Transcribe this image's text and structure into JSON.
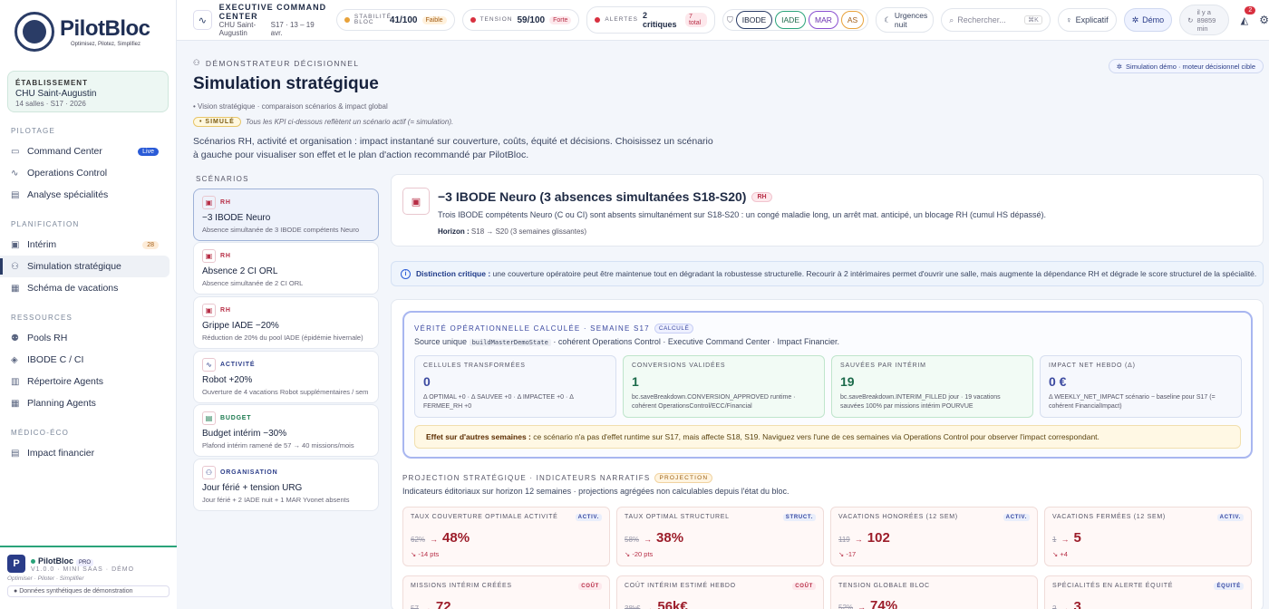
{
  "brand": {
    "name": "PilotBloc",
    "tagline": "Optimisez, Pilotez, Simplifiez"
  },
  "etab": {
    "label": "ÉTABLISSEMENT",
    "name": "CHU Saint-Augustin",
    "sub": "14 salles · S17 · 2026"
  },
  "nav": {
    "pilotage": "PILOTAGE",
    "planification": "PLANIFICATION",
    "ressources": "RESSOURCES",
    "medico": "MÉDICO-ÉCO",
    "command": "Command Center",
    "live": "Live",
    "ops": "Operations Control",
    "analyse": "Analyse spécialités",
    "interim": "Intérim",
    "interim_count": "28",
    "simulation": "Simulation stratégique",
    "vacances": "Schéma de vacations",
    "pools": "Pools RH",
    "ibode": "IBODE C / CI",
    "repertoire": "Répertoire Agents",
    "planning": "Planning Agents",
    "impact": "Impact financier"
  },
  "footer": {
    "initial": "P",
    "name": "PilotBloc",
    "pro": "PRO",
    "version": "V1.0.0 · MINI SAAS · DÉMO",
    "tag": "Optimiser · Piloter · Simplifier",
    "note": "Données synthétiques de démonstration"
  },
  "top": {
    "ecc_title": "EXECUTIVE COMMAND CENTER",
    "ecc_site": "CHU Saint-Augustin",
    "ecc_week": "S17 · 13 – 19 avr.",
    "stab_k": "STABILITÉ BLOC",
    "stab_v": "41/100",
    "stab_tag": "Faible",
    "tens_k": "TENSION",
    "tens_v": "59/100",
    "tens_tag": "Forte",
    "alert_k": "ALERTES",
    "alert_v": "2 critiques",
    "alert_tag": "7 total",
    "chips": [
      "IBODE",
      "IADE",
      "MAR",
      "AS"
    ],
    "urgences": "Urgences nuit",
    "search": "Rechercher...",
    "kbd": "⌘K",
    "explicatif": "Explicatif",
    "demo": "Démo",
    "refresh": "il y a 89859 min",
    "notif": "2"
  },
  "page": {
    "crumb": "DÉMONSTRATEUR DÉCISIONNEL",
    "sim_btn": "Simulation démo · moteur décisionnel cible",
    "title": "Simulation stratégique",
    "vision": "• Vision stratégique · comparaison scénarios & impact global",
    "simtag": "• SIMULÉ",
    "simnote": "Tous les KPI ci-dessous reflètent un scénario actif (= simulation).",
    "desc": "Scénarios RH, activité et organisation : impact instantané sur couverture, coûts, équité et décisions. Choisissez un scénario à gauche pour visualiser son effet et le plan d'action recommandé par PilotBloc.",
    "scen_label": "SCÉNARIOS"
  },
  "scenarios": [
    {
      "k": "RH",
      "t": "−3 IBODE Neuro",
      "s": "Absence simultanée de 3 IBODE compétents Neuro",
      "c": "#b72e46",
      "ic": "▣"
    },
    {
      "k": "RH",
      "t": "Absence 2 CI ORL",
      "s": "Absence simultanée de 2 CI ORL",
      "c": "#b72e46",
      "ic": "▣"
    },
    {
      "k": "RH",
      "t": "Grippe IADE −20%",
      "s": "Réduction de 20% du pool IADE (épidémie hivernale)",
      "c": "#b72e46",
      "ic": "▣"
    },
    {
      "k": "ACTIVITÉ",
      "t": "Robot +20%",
      "s": "Ouverture de 4 vacations Robot supplémentaires / sem",
      "c": "#2a3c88",
      "ic": "∿"
    },
    {
      "k": "BUDGET",
      "t": "Budget intérim −30%",
      "s": "Plafond intérim ramené de 57 → 40 missions/mois",
      "c": "#1b7a4f",
      "ic": "▤"
    },
    {
      "k": "ORGANISATION",
      "t": "Jour férié + tension URG",
      "s": "Jour férié + 2 IADE nuit + 1 MAR Yvonet absents",
      "c": "#2a3c88",
      "ic": "⚇"
    }
  ],
  "detail": {
    "title": "−3 IBODE Neuro (3 absences simultanées S18-S20)",
    "tag": "RH",
    "desc": "Trois IBODE compétents Neuro (C ou CI) sont absents simultanément sur S18-S20 : un congé maladie long, un arrêt mat. anticipé, un blocage RH (cumul HS dépassé).",
    "horizon_k": "Horizon :",
    "horizon_v": "S18 → S20 (3 semaines glissantes)"
  },
  "critical": {
    "k": "Distinction critique :",
    "v": "une couverture opératoire peut être maintenue tout en dégradant la robustesse structurelle. Recourir à 2 intérimaires permet d'ouvrir une salle, mais augmente la dépendance RH et dégrade le score structurel de la spécialité."
  },
  "verite": {
    "title": "VÉRITÉ OPÉRATIONNELLE CALCULÉE · SEMAINE S17",
    "tag": "CALCULÉ",
    "src1": "Source unique",
    "code": "buildMasterDemoState",
    "src2": "· cohérent Operations Control · Executive Command Center · Impact Financier.",
    "boxes": [
      {
        "k": "CELLULES TRANSFORMÉES",
        "v": "0",
        "s": "Δ OPTIMAL +0 · Δ SAUVEE +0 · Δ IMPACTEE +0 · Δ FERMEE_RH +0"
      },
      {
        "k": "CONVERSIONS VALIDÉES",
        "v": "1",
        "s": "bc.saveBreakdown.CONVERSION_APPROVED runtime · cohérent OperationsControl/ECC/Financial"
      },
      {
        "k": "SAUVÉES PAR INTÉRIM",
        "v": "19",
        "s": "bc.saveBreakdown.INTERIM_FILLED jour · 19 vacations sauvées 100% par missions intérim POURVUE"
      },
      {
        "k": "IMPACT NET HEBDO (Δ)",
        "v": "0 €",
        "s": "Δ WEEKLY_NET_IMPACT scénario − baseline pour S17 (= cohérent FinancialImpact)"
      }
    ],
    "effect_k": "Effet sur d'autres semaines :",
    "effect_v": "ce scénario n'a pas d'effet runtime sur S17, mais affecte S18, S19. Naviguez vers l'une de ces semaines via Operations Control pour observer l'impact correspondant."
  },
  "proj": {
    "title": "PROJECTION STRATÉGIQUE · INDICATEURS NARRATIFS",
    "tag": "PROJECTION",
    "sub": "Indicateurs éditoriaux sur horizon 12 semaines · projections agrégées non calculables depuis l'état du bloc.",
    "kpis": [
      {
        "k": "TAUX COUVERTURE OPTIMALE ACTIVITÉ",
        "t": "ACTIV.",
        "old": "62%",
        "new": "48%",
        "d": "↘ -14 pts"
      },
      {
        "k": "TAUX OPTIMAL STRUCTUREL",
        "t": "STRUCT.",
        "old": "58%",
        "new": "38%",
        "d": "↘ -20 pts"
      },
      {
        "k": "VACATIONS HONORÉES (12 SEM)",
        "t": "ACTIV.",
        "old": "119",
        "new": "102",
        "d": "↘ -17"
      },
      {
        "k": "VACATIONS FERMÉES (12 SEM)",
        "t": "ACTIV.",
        "old": "1",
        "new": "5",
        "d": "↘ +4"
      },
      {
        "k": "MISSIONS INTÉRIM CRÉÉES",
        "t": "COÛT",
        "old": "57",
        "new": "72",
        "d": ""
      },
      {
        "k": "COÛT INTÉRIM ESTIMÉ HEBDO",
        "t": "COÛT",
        "old": "38k€",
        "new": "56k€",
        "d": ""
      },
      {
        "k": "TENSION GLOBALE BLOC",
        "t": "",
        "old": "52%",
        "new": "74%",
        "d": ""
      },
      {
        "k": "SPÉCIALITÉS EN ALERTE ÉQUITÉ",
        "t": "ÉQUITÉ",
        "old": "2",
        "new": "3",
        "d": ""
      }
    ]
  }
}
